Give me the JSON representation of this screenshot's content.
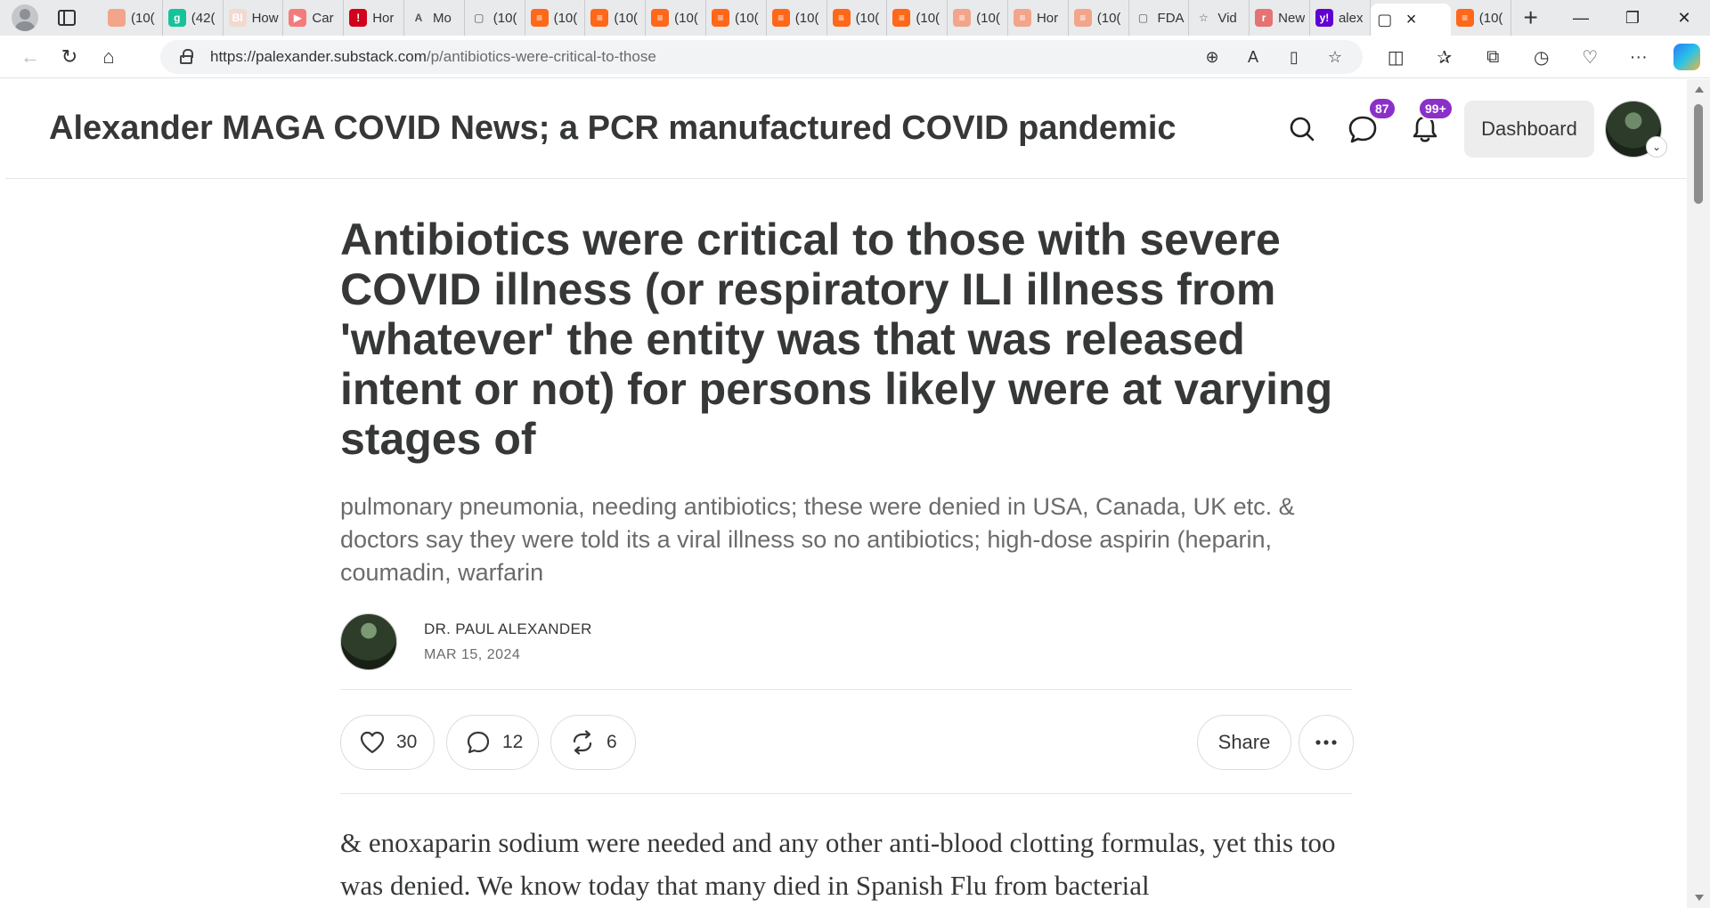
{
  "browser": {
    "tabs": [
      {
        "label": "(10(",
        "fav_color": "#f2a58a",
        "fav_glyph": ""
      },
      {
        "label": "(42(",
        "fav_color": "#15c39a",
        "fav_glyph": "g"
      },
      {
        "label": "How",
        "fav_color": "#f4d9d0",
        "fav_glyph": "BI"
      },
      {
        "label": "Car",
        "fav_color": "#f57b7b",
        "fav_glyph": "▶"
      },
      {
        "label": "Hor",
        "fav_color": "#d0021b",
        "fav_glyph": "!"
      },
      {
        "label": "Mo",
        "fav_color": "#e9eaec",
        "fav_glyph": "A"
      },
      {
        "label": "(10(",
        "fav_color": "#e9eaec",
        "fav_glyph": "▢"
      },
      {
        "label": "(10(",
        "fav_color": "#ff6719",
        "fav_glyph": "≡"
      },
      {
        "label": "(10(",
        "fav_color": "#ff6719",
        "fav_glyph": "≡"
      },
      {
        "label": "(10(",
        "fav_color": "#ff6719",
        "fav_glyph": "≡"
      },
      {
        "label": "(10(",
        "fav_color": "#ff6719",
        "fav_glyph": "≡"
      },
      {
        "label": "(10(",
        "fav_color": "#ff6719",
        "fav_glyph": "≡"
      },
      {
        "label": "(10(",
        "fav_color": "#ff6719",
        "fav_glyph": "≡"
      },
      {
        "label": "(10(",
        "fav_color": "#ff6719",
        "fav_glyph": "≡"
      },
      {
        "label": "(10(",
        "fav_color": "#f2a58a",
        "fav_glyph": "≡"
      },
      {
        "label": "Hor",
        "fav_color": "#f2a58a",
        "fav_glyph": "≡"
      },
      {
        "label": "(10(",
        "fav_color": "#f2a58a",
        "fav_glyph": "≡"
      },
      {
        "label": "FDA",
        "fav_color": "#e9eaec",
        "fav_glyph": "▢"
      },
      {
        "label": "Vid",
        "fav_color": "#e9eaec",
        "fav_glyph": "☆"
      },
      {
        "label": "New",
        "fav_color": "#e57373",
        "fav_glyph": "r"
      },
      {
        "label": "alex",
        "fav_color": "#6001d2",
        "fav_glyph": "y!"
      }
    ],
    "active_tab": {
      "label": "",
      "fav_glyph": "▢"
    },
    "last_tab": {
      "label": "(10(",
      "fav_color": "#ff6719",
      "fav_glyph": "≡"
    },
    "url_host": "https://palexander.substack.com",
    "url_path": "/p/antibiotics-were-critical-to-those"
  },
  "site": {
    "title": "Alexander MAGA COVID News; a PCR manufactured COVID pandemic",
    "messages_badge": "87",
    "notifications_badge": "99+",
    "dashboard_label": "Dashboard"
  },
  "article": {
    "title": "Antibiotics were critical to those with severe COVID illness (or respiratory ILI illness from 'whatever' the entity was that was released intent or not) for persons likely were at varying stages of",
    "subtitle": "pulmonary pneumonia, needing antibiotics; these were denied in USA, Canada, UK etc. & doctors say they were told its a viral illness so no antibiotics; high-dose aspirin (heparin, coumadin, warfarin",
    "author": "DR. PAUL ALEXANDER",
    "date": "MAR 15, 2024",
    "likes": "30",
    "comments": "12",
    "restacks": "6",
    "share_label": "Share",
    "body": "& enoxaparin sodium were needed and any other anti-blood clotting formulas, yet this too was denied. We know today that many died in Spanish Flu from bacterial"
  }
}
